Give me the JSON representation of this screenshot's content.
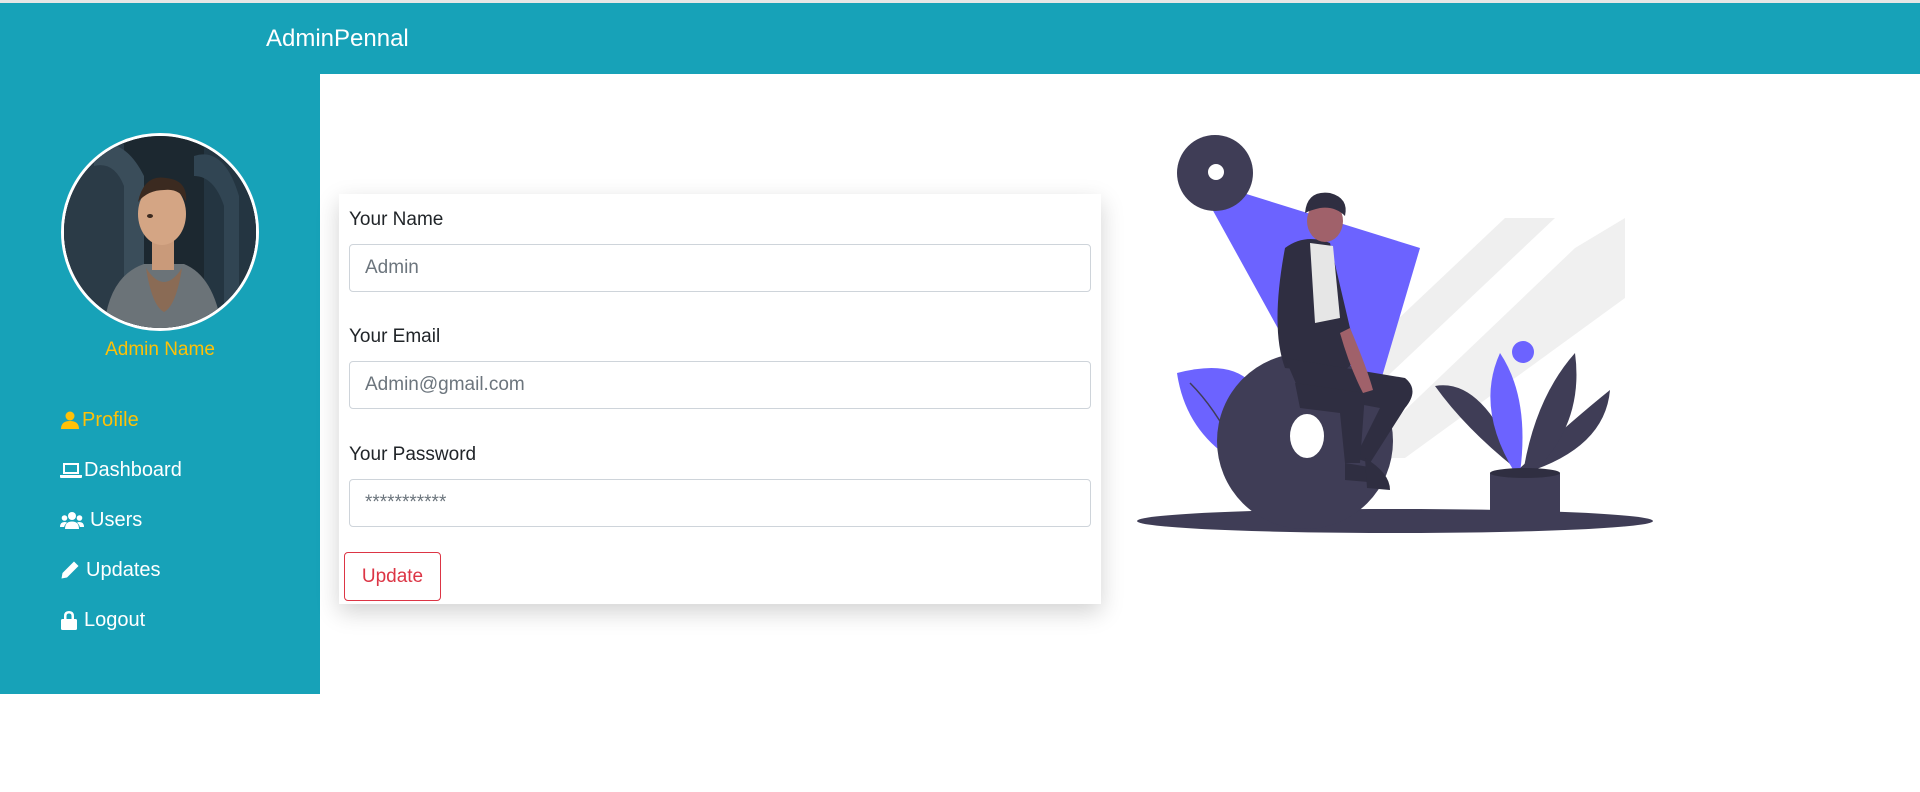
{
  "app": {
    "brand": "AdminPennal"
  },
  "sidebar": {
    "admin_name": "Admin Name",
    "items": [
      {
        "label": "Profile",
        "icon": "user-icon",
        "active": true
      },
      {
        "label": "Dashboard",
        "icon": "laptop-icon",
        "active": false
      },
      {
        "label": "Users",
        "icon": "users-icon",
        "active": false
      },
      {
        "label": "Updates",
        "icon": "pencil-icon",
        "active": false
      },
      {
        "label": "Logout",
        "icon": "lock-icon",
        "active": false
      }
    ]
  },
  "form": {
    "name_label": "Your Name",
    "name_placeholder": "Admin",
    "email_label": "Your Email",
    "email_placeholder": "Admin@gmail.com",
    "password_label": "Your Password",
    "password_placeholder": "***********",
    "submit_label": "Update"
  },
  "colors": {
    "primary": "#17a2b8",
    "accent": "#ffc107",
    "danger": "#dc3545",
    "illustration": "#6c63ff"
  }
}
